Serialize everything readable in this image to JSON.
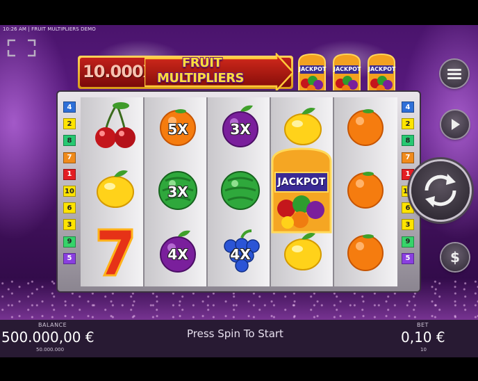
{
  "status_bar": {
    "time": "10:26 AM",
    "sep": "|",
    "title": "FRUIT MULTIPLIERS DEMO"
  },
  "banner": {
    "multiplier": "10.000X",
    "title_line1": "FRUIT",
    "title_line2": "MULTIPLIERS",
    "jackpot_label": "JACKPOT"
  },
  "paylines_left": [
    "4",
    "2",
    "8",
    "7",
    "1",
    "10",
    "6",
    "3",
    "9",
    "5"
  ],
  "paylines_right": [
    "4",
    "2",
    "8",
    "7",
    "1",
    "10",
    "6",
    "3",
    "9",
    "5"
  ],
  "payline_colors": {
    "1": "#e31e24",
    "2": "#ffe400",
    "3": "#ffe400",
    "4": "#2f6fd8",
    "5": "#8a3fe0",
    "6": "#ffe400",
    "7": "#f08a1c",
    "8": "#28c872",
    "9": "#36d46a",
    "10": "#ffe400"
  },
  "reels": [
    [
      {
        "symbol": "cherry"
      },
      {
        "symbol": "lemon"
      },
      {
        "symbol": "seven"
      }
    ],
    [
      {
        "symbol": "orange",
        "multiplier": "5X"
      },
      {
        "symbol": "watermelon",
        "multiplier": "3X"
      },
      {
        "symbol": "plum",
        "multiplier": "4X"
      }
    ],
    [
      {
        "symbol": "plum",
        "multiplier": "3X"
      },
      {
        "symbol": "watermelon"
      },
      {
        "symbol": "grapes",
        "multiplier": "4X"
      }
    ],
    [
      {
        "symbol": "lemon"
      },
      {
        "symbol": "jackpot",
        "label": "JACKPOT"
      },
      {
        "symbol": "lemon"
      }
    ],
    [
      {
        "symbol": "orange"
      },
      {
        "symbol": "orange"
      },
      {
        "symbol": "orange"
      }
    ]
  ],
  "controls": {
    "menu_icon": "hamburger-icon",
    "autoplay_icon": "play-icon",
    "spin_icon": "spin-arrows-icon",
    "bet_icon": "dollar-icon",
    "fullscreen_icon": "fullscreen-icon"
  },
  "footer": {
    "balance_label": "BALANCE",
    "balance_value": "500.000,00 €",
    "balance_sub": "50.000.000",
    "message": "Press Spin To Start",
    "bet_label": "BET",
    "bet_value": "0,10 €",
    "bet_sub": "10"
  }
}
